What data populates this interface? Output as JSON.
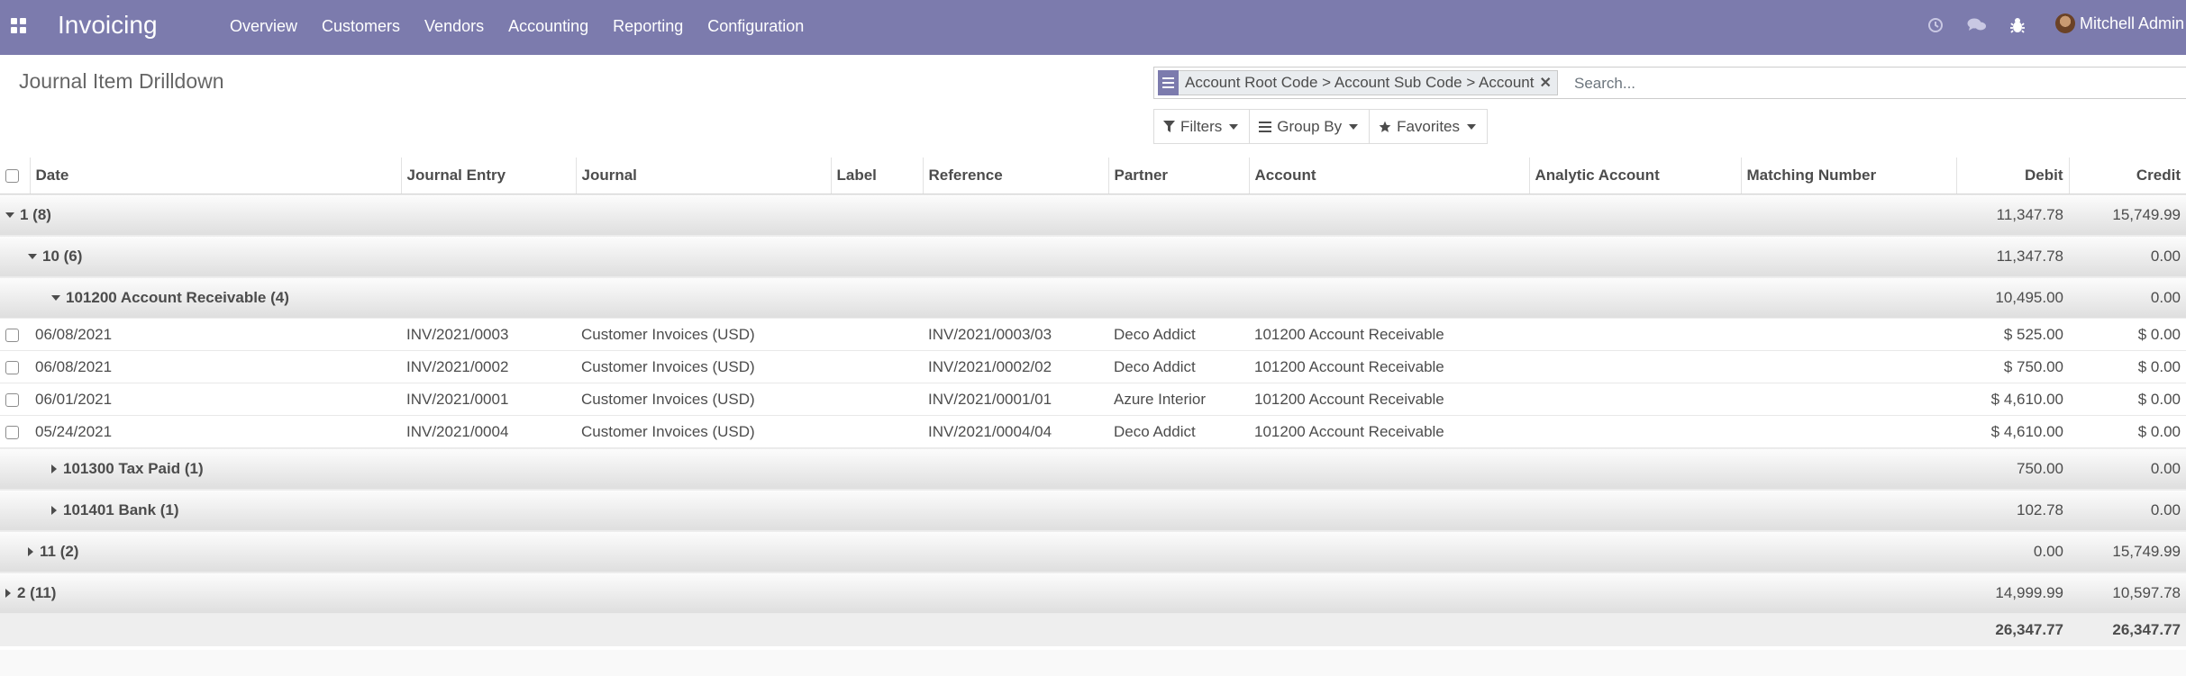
{
  "navbar": {
    "app_name": "Invoicing",
    "menu": [
      "Overview",
      "Customers",
      "Vendors",
      "Accounting",
      "Reporting",
      "Configuration"
    ],
    "user_name": "Mitchell Admin",
    "systray_icons": [
      "clock-icon",
      "chat-icon",
      "bug-icon"
    ]
  },
  "control_panel": {
    "title": "Journal Item Drilldown",
    "search": {
      "facet_text": "Account Root Code > Account Sub Code > Account",
      "placeholder": "Search..."
    },
    "buttons": {
      "filters": "Filters",
      "group_by": "Group By",
      "favorites": "Favorites"
    }
  },
  "table": {
    "columns": [
      "Date",
      "Journal Entry",
      "Journal",
      "Label",
      "Reference",
      "Partner",
      "Account",
      "Analytic Account",
      "Matching Number",
      "Debit",
      "Credit"
    ],
    "groups": [
      {
        "label": "1 (8)",
        "debit": "11,347.78",
        "credit": "15,749.99"
      },
      {
        "label": "10 (6)",
        "debit": "11,347.78",
        "credit": "0.00"
      },
      {
        "label": "101200 Account Receivable (4)",
        "debit": "10,495.00",
        "credit": "0.00"
      },
      {
        "label": "101300 Tax Paid (1)",
        "debit": "750.00",
        "credit": "0.00"
      },
      {
        "label": "101401 Bank (1)",
        "debit": "102.78",
        "credit": "0.00"
      },
      {
        "label": "11 (2)",
        "debit": "0.00",
        "credit": "15,749.99"
      },
      {
        "label": "2 (11)",
        "debit": "14,999.99",
        "credit": "10,597.78"
      }
    ],
    "rows": [
      {
        "date": "06/08/2021",
        "entry": "INV/2021/0003",
        "journal": "Customer Invoices (USD)",
        "label": "",
        "reference": "INV/2021/0003/03",
        "partner": "Deco Addict",
        "account": "101200 Account Receivable",
        "analytic": "",
        "matching": "",
        "debit": "$ 525.00",
        "credit": "$ 0.00"
      },
      {
        "date": "06/08/2021",
        "entry": "INV/2021/0002",
        "journal": "Customer Invoices (USD)",
        "label": "",
        "reference": "INV/2021/0002/02",
        "partner": "Deco Addict",
        "account": "101200 Account Receivable",
        "analytic": "",
        "matching": "",
        "debit": "$ 750.00",
        "credit": "$ 0.00"
      },
      {
        "date": "06/01/2021",
        "entry": "INV/2021/0001",
        "journal": "Customer Invoices (USD)",
        "label": "",
        "reference": "INV/2021/0001/01",
        "partner": "Azure Interior",
        "account": "101200 Account Receivable",
        "analytic": "",
        "matching": "",
        "debit": "$ 4,610.00",
        "credit": "$ 0.00"
      },
      {
        "date": "05/24/2021",
        "entry": "INV/2021/0004",
        "journal": "Customer Invoices (USD)",
        "label": "",
        "reference": "INV/2021/0004/04",
        "partner": "Deco Addict",
        "account": "101200 Account Receivable",
        "analytic": "",
        "matching": "",
        "debit": "$ 4,610.00",
        "credit": "$ 0.00"
      }
    ],
    "totals": {
      "debit": "26,347.77",
      "credit": "26,347.77"
    }
  }
}
